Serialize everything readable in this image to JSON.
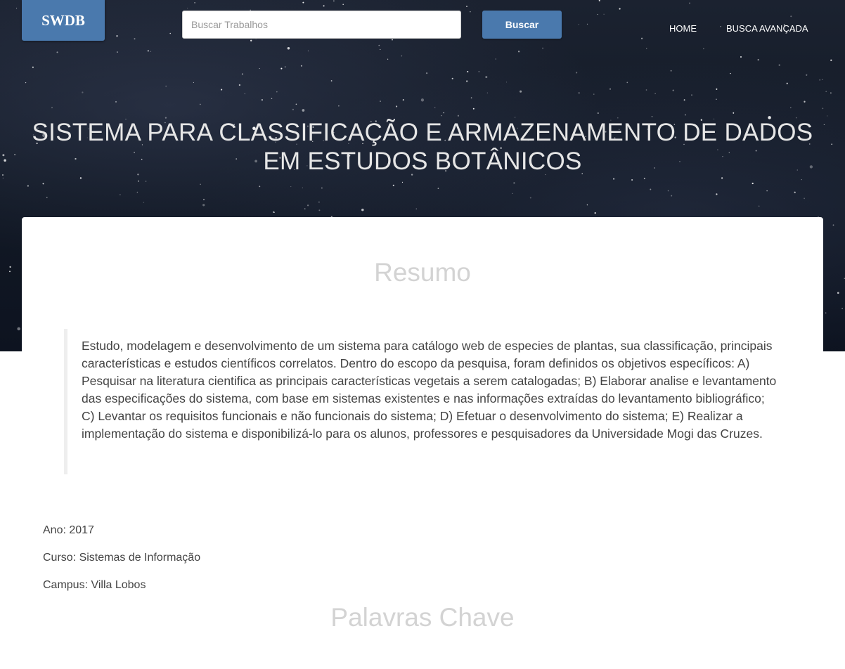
{
  "header": {
    "brand": "SWDB",
    "search": {
      "placeholder": "Buscar Trabalhos",
      "button_label": "Buscar"
    },
    "nav": {
      "home": "HOME",
      "advanced_search": "BUSCA AVANÇADA"
    }
  },
  "hero": {
    "title": "SISTEMA PARA CLASSIFICAÇÃO E ARMAZENAMENTO DE DADOS EM ESTUDOS BOTÂNICOS"
  },
  "content": {
    "abstract_heading": "Resumo",
    "abstract": "Estudo, modelagem e desenvolvimento de um sistema para catálogo web de especies de plantas, sua classificação, principais características e estudos científicos correlatos. Dentro do escopo da pesquisa, foram definidos os objetivos específicos: A) Pesquisar na literatura cientifica as principais características vegetais a serem catalogadas; B) Elaborar analise e levantamento das especificações do sistema, com base em sistemas existentes e nas informações extraídas do levantamento bibliográfico; C) Levantar os requisitos funcionais e não funcionais do sistema; D) Efetuar o desenvolvimento do sistema; E) Realizar a implementação do sistema e disponibilizá-lo para os alunos, professores e pesquisadores da Universidade Mogi das Cruzes.",
    "year": "Ano: 2017",
    "course": "Curso: Sistemas de Informação",
    "campus": "Campus: Villa Lobos",
    "keywords_heading": "Palavras Chave"
  },
  "colors": {
    "accent": "#4a79ad",
    "hero_bg": "#141b27",
    "heading_muted": "#d3d3d3"
  }
}
